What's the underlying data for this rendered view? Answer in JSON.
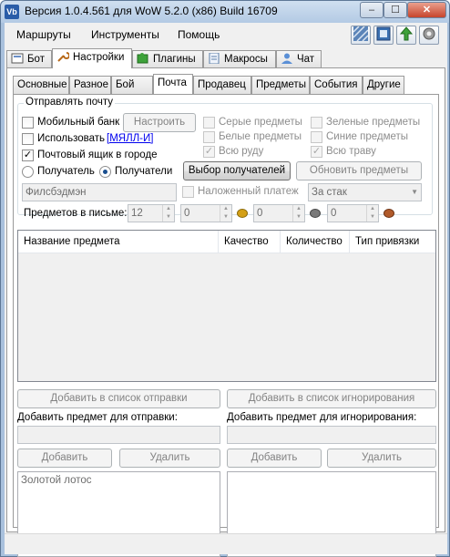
{
  "window": {
    "title": "Версия 1.0.4.561 для WoW 5.2.0 (x86) Build 16709",
    "app_icon_text": "Vb",
    "controls": {
      "minimize": "–",
      "maximize": "☐",
      "close": "✕"
    }
  },
  "menu": {
    "items": [
      "Маршруты",
      "Инструменты",
      "Помощь"
    ],
    "toolbar_icons": [
      "stripes-icon",
      "frame-icon",
      "up-arrow-icon",
      "gear-icon"
    ]
  },
  "main_tabs": [
    "Бот",
    "Настройки",
    "Плагины",
    "Макросы",
    "Чат"
  ],
  "main_tab_active": "Настройки",
  "sub_tabs": [
    "Основные",
    "Разное",
    "Бой",
    "Почта",
    "Продавец",
    "Предметы",
    "События",
    "Другие"
  ],
  "sub_tab_active": "Почта",
  "mail": {
    "group_label": "Отправлять почту",
    "mobile_bank_label": "Мобильный банк",
    "mobile_bank_checked": false,
    "configure_button": "Настроить",
    "use_label": "Использовать",
    "use_link": "[МЯЛЛ-И]",
    "use_checked": false,
    "mailbox_label": "Почтовый ящик в городе",
    "mailbox_checked": true,
    "recipient_label": "Получатель",
    "recipients_label": "Получатели",
    "recipients_selected": "Получатели",
    "select_recipients_button": "Выбор получателей",
    "refresh_items_button": "Обновить предметы",
    "recipient_name": "Филсбэдмэн",
    "cod_label": "Наложенный платеж",
    "cod_checked": false,
    "stack_option": "За стак",
    "items_per_letter_label": "Предметов в письме:",
    "items_per_letter_value": "12",
    "gold_value": "0",
    "silver_value": "0",
    "copper_value": "0",
    "quality_filters": {
      "gray": {
        "label": "Серые предметы",
        "checked": false
      },
      "white": {
        "label": "Белые предметы",
        "checked": false
      },
      "all_ore": {
        "label": "Всю руду",
        "checked": true
      },
      "green": {
        "label": "Зеленые предметы",
        "checked": false
      },
      "blue": {
        "label": "Синие предметы",
        "checked": false
      },
      "all_herbs": {
        "label": "Всю траву",
        "checked": true
      }
    }
  },
  "items_table": {
    "columns": [
      "Название предмета",
      "Качество",
      "Количество",
      "Тип привязки"
    ],
    "rows": []
  },
  "lists": {
    "add_to_send_button": "Добавить в список отправки",
    "add_to_ignore_button": "Добавить в список игнорирования",
    "add_send_label": "Добавить предмет для отправки:",
    "add_ignore_label": "Добавить предмет для игнорирования:",
    "add_button": "Добавить",
    "remove_button": "Удалить",
    "send_items": [
      "Золотой лотос"
    ],
    "ignore_items": []
  },
  "colors": {
    "gold_coin": "#d4a017",
    "silver_coin": "#7a7a7a",
    "copper_coin": "#b05a2a",
    "link": "#0000ee",
    "title_bar": "#b3cae4"
  }
}
